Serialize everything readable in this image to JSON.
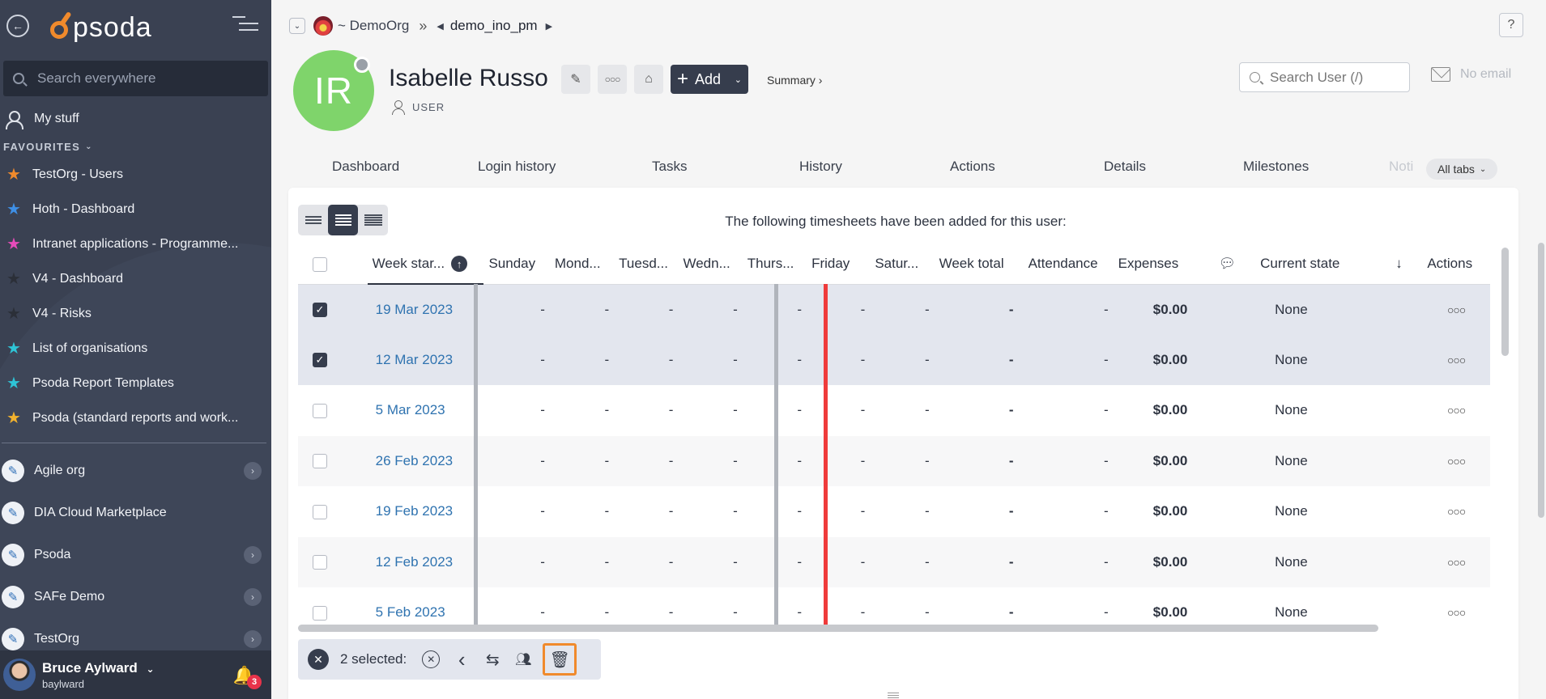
{
  "sidebar": {
    "logo_text": "psoda",
    "search_placeholder": "Search everywhere",
    "my_stuff": "My stuff",
    "favourites_label": "FAVOURITES",
    "favourites": [
      {
        "label": "TestOrg - Users",
        "color": "#f08a2c"
      },
      {
        "label": "Hoth - Dashboard",
        "color": "#3e8fe6"
      },
      {
        "label": "Intranet applications - Programme...",
        "color": "#e64bb9"
      },
      {
        "label": "V4 - Dashboard",
        "color": "#2b2f38"
      },
      {
        "label": "V4 - Risks",
        "color": "#2b2f38"
      },
      {
        "label": "List of organisations",
        "color": "#2ec4d6"
      },
      {
        "label": "Psoda Report Templates",
        "color": "#2ec4d6"
      },
      {
        "label": "Psoda (standard reports and work...",
        "color": "#f2b22e"
      }
    ],
    "orgs": [
      {
        "label": "Agile org",
        "arrow": true
      },
      {
        "label": "DIA Cloud Marketplace",
        "arrow": false
      },
      {
        "label": "Psoda",
        "arrow": true
      },
      {
        "label": "SAFe Demo",
        "arrow": true
      },
      {
        "label": "TestOrg",
        "arrow": true
      }
    ],
    "user": {
      "name": "Bruce Aylward",
      "username": "baylward",
      "notifications": "3"
    }
  },
  "breadcrumb": {
    "org": "~ DemoOrg",
    "current": "demo_ino_pm"
  },
  "profile": {
    "initials": "IR",
    "name": "Isabelle Russo",
    "role": "USER",
    "add_label": "Add",
    "summary_label": "Summary ›",
    "search_placeholder": "Search User (/)",
    "email_text": "No email",
    "avatar_color": "#7fd46b"
  },
  "tabs": [
    "Dashboard",
    "Login history",
    "Tasks",
    "History",
    "Actions",
    "Details",
    "Milestones",
    "Noti"
  ],
  "all_tabs_label": "All tabs",
  "panel": {
    "caption": "The following timesheets have been added for this user:",
    "columns": [
      "Week star...",
      "Sunday",
      "Mond...",
      "Tuesd...",
      "Wedn...",
      "Thurs...",
      "Friday",
      "Satur...",
      "Week total",
      "Attendance",
      "Expenses",
      "",
      "Current state",
      "",
      "Actions"
    ],
    "rows": [
      {
        "week": "19 Mar 2023",
        "checked": true,
        "expenses": "$0.00",
        "state": "None"
      },
      {
        "week": "12 Mar 2023",
        "checked": true,
        "expenses": "$0.00",
        "state": "None"
      },
      {
        "week": "5 Mar 2023",
        "checked": false,
        "expenses": "$0.00",
        "state": "None"
      },
      {
        "week": "26 Feb 2023",
        "checked": false,
        "expenses": "$0.00",
        "state": "None"
      },
      {
        "week": "19 Feb 2023",
        "checked": false,
        "expenses": "$0.00",
        "state": "None"
      },
      {
        "week": "12 Feb 2023",
        "checked": false,
        "expenses": "$0.00",
        "state": "None"
      },
      {
        "week": "5 Feb 2023",
        "checked": false,
        "expenses": "$0.00",
        "state": "None"
      }
    ],
    "dash": "-",
    "bulk_label": "2 selected:"
  },
  "colors": {
    "sidebar_bg": "#3a4152",
    "accent_dark": "#363d4d",
    "link": "#2f73b0",
    "orange": "#f08a2c",
    "red_rule": "#ef3b3b"
  }
}
